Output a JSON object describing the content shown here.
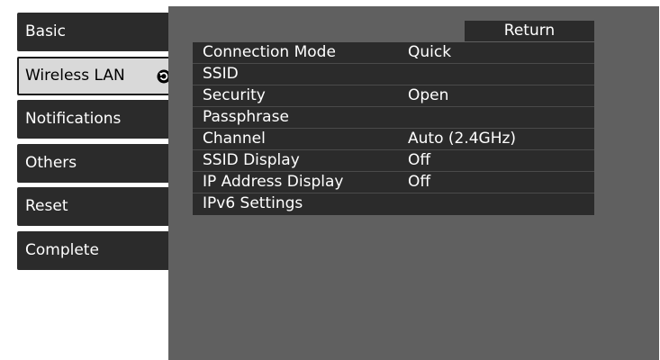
{
  "sidebar": {
    "items": [
      {
        "label": "Basic"
      },
      {
        "label": "Wireless LAN"
      },
      {
        "label": "Notifications"
      },
      {
        "label": "Others"
      },
      {
        "label": "Reset"
      },
      {
        "label": "Complete"
      }
    ],
    "selected_icon": "circle-arrow-icon"
  },
  "panel": {
    "return_label": "Return",
    "rows": [
      {
        "label": "Connection Mode",
        "value": "Quick"
      },
      {
        "label": "SSID",
        "value": ""
      },
      {
        "label": "Security",
        "value": "Open"
      },
      {
        "label": "Passphrase",
        "value": ""
      },
      {
        "label": "Channel",
        "value": "Auto (2.4GHz)"
      },
      {
        "label": "SSID Display",
        "value": "Off"
      },
      {
        "label": "IP Address Display",
        "value": "Off"
      },
      {
        "label": "IPv6 Settings",
        "value": ""
      }
    ]
  },
  "colors": {
    "menu_bg": "#2b2b2b",
    "panel_bg": "#606060",
    "selected_bg": "#d9d9d9",
    "text_light": "#ffffff",
    "text_dark": "#000000"
  }
}
